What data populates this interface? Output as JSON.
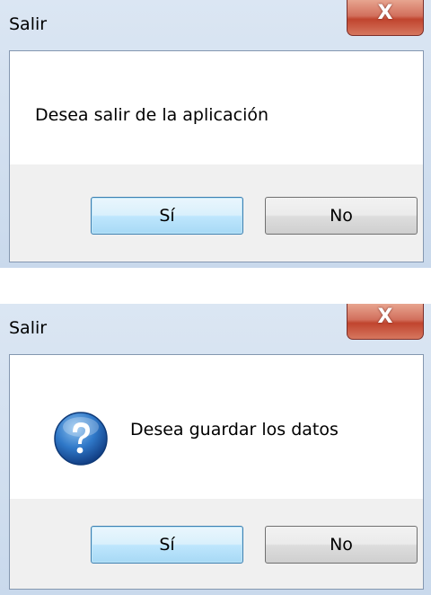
{
  "dialogs": [
    {
      "title": "Salir",
      "close_glyph": "X",
      "message": "Desea salir de la aplicación",
      "icon": null,
      "buttons": {
        "yes": "Sí",
        "no": "No"
      },
      "default_button": "yes"
    },
    {
      "title": "Salir",
      "close_glyph": "X",
      "message": "Desea guardar los datos",
      "icon": "question-icon",
      "buttons": {
        "yes": "Sí",
        "no": "No"
      },
      "default_button": "yes"
    }
  ],
  "colors": {
    "frame": "#c9d9ec",
    "close_button": "#c0442e",
    "default_button_border": "#3c7fb1",
    "question_icon": "#1f5fa8"
  }
}
